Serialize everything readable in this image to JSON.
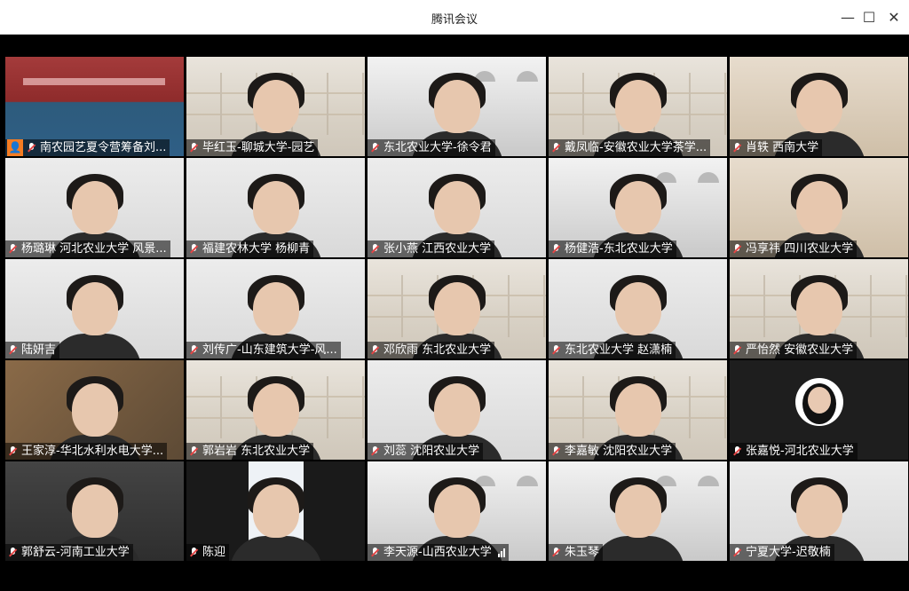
{
  "window": {
    "title": "腾讯会议"
  },
  "controls": {
    "minimize": "—",
    "maximize": "☐",
    "close": "✕"
  },
  "participants": [
    {
      "name": "南农园艺夏令营筹备刘...",
      "bg": "stage",
      "host": true
    },
    {
      "name": "毕红玉-聊城大学-园艺",
      "bg": "shelf"
    },
    {
      "name": "东北农业大学-徐令君",
      "bg": "room"
    },
    {
      "name": "戴凤临-安徽农业大学茶学...",
      "bg": "shelf"
    },
    {
      "name": "肖轶 西南大学",
      "bg": "warm"
    },
    {
      "name": "杨璐琳 河北农业大学 风景...",
      "bg": "bright"
    },
    {
      "name": "福建农林大学 杨柳青",
      "bg": "bright"
    },
    {
      "name": "张小燕 江西农业大学",
      "bg": "bright"
    },
    {
      "name": "杨健浩-东北农业大学",
      "bg": "room"
    },
    {
      "name": "冯享祎 四川农业大学",
      "bg": "warm"
    },
    {
      "name": "陆妍吉",
      "bg": "bright"
    },
    {
      "name": "刘传广-山东建筑大学-风...",
      "bg": "bright"
    },
    {
      "name": "邓欣雨 东北农业大学",
      "bg": "shelf"
    },
    {
      "name": "东北农业大学 赵潇楠",
      "bg": "bright"
    },
    {
      "name": "严怡然 安徽农业大学",
      "bg": "shelf"
    },
    {
      "name": "王家淳-华北水利水电大学...",
      "bg": "tiles"
    },
    {
      "name": "郭岩岩 东北农业大学",
      "bg": "shelf"
    },
    {
      "name": "刘蕊 沈阳农业大学",
      "bg": "bright"
    },
    {
      "name": "李嘉敏 沈阳农业大学",
      "bg": "shelf"
    },
    {
      "name": "张嘉悦-河北农业大学",
      "bg": "black",
      "avatar": true
    },
    {
      "name": "郭舒云-河南工业大学",
      "bg": "dark"
    },
    {
      "name": "陈迎",
      "bg": "phone"
    },
    {
      "name": "李天源-山西农业大学",
      "bg": "room",
      "signal": true
    },
    {
      "name": "朱玉琴",
      "bg": "room"
    },
    {
      "name": "宁夏大学-迟敬楠",
      "bg": "bright"
    }
  ]
}
